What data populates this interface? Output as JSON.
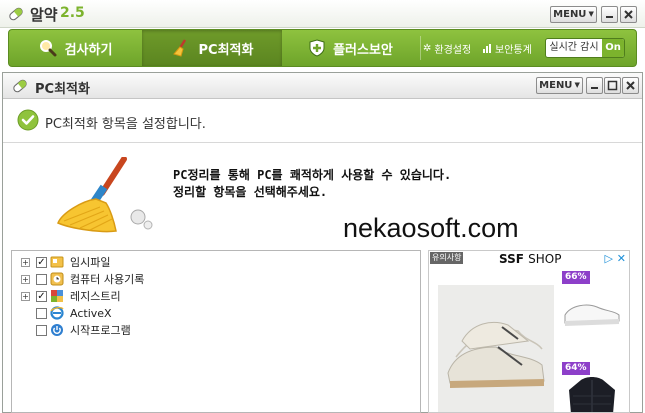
{
  "app": {
    "name": "알약",
    "version": "2.5",
    "menu_label": "MENU"
  },
  "nav": {
    "tabs": [
      {
        "label": "검사하기",
        "icon": "magnifier-icon",
        "active": false
      },
      {
        "label": "PC최적화",
        "icon": "broom-icon",
        "active": true
      },
      {
        "label": "플러스보안",
        "icon": "shield-plus-icon",
        "active": false
      }
    ],
    "settings_label": "환경설정",
    "stats_label": "보안통계",
    "realtime_label": "실시간 감시",
    "realtime_state": "On"
  },
  "panel": {
    "title": "PC최적화",
    "menu_label": "MENU",
    "status_text": "PC최적화 항목을 설정합니다.",
    "intro_line1": "PC정리를 통해 PC를 쾌적하게 사용할 수 있습니다.",
    "intro_line2": "정리할 항목을 선택해주세요."
  },
  "watermark": "nekaosoft.com",
  "tree": {
    "items": [
      {
        "label": "임시파일",
        "expandable": true,
        "checked": true,
        "icon": "folder-icon"
      },
      {
        "label": "컴퓨터 사용기록",
        "expandable": true,
        "checked": false,
        "icon": "history-icon"
      },
      {
        "label": "레지스트리",
        "expandable": true,
        "checked": true,
        "icon": "registry-icon"
      },
      {
        "label": "ActiveX",
        "expandable": false,
        "checked": false,
        "icon": "ie-icon"
      },
      {
        "label": "시작프로그램",
        "expandable": false,
        "checked": false,
        "icon": "power-icon"
      }
    ]
  },
  "ad": {
    "tag": "유의사항",
    "brand": "SSF",
    "brand_suffix": "SHOP",
    "discounts": [
      "66%",
      "64%"
    ]
  },
  "colors": {
    "brand_green": "#7cb32d",
    "nav_green_dark": "#5b8520",
    "discount_purple": "#8d3fc9"
  }
}
